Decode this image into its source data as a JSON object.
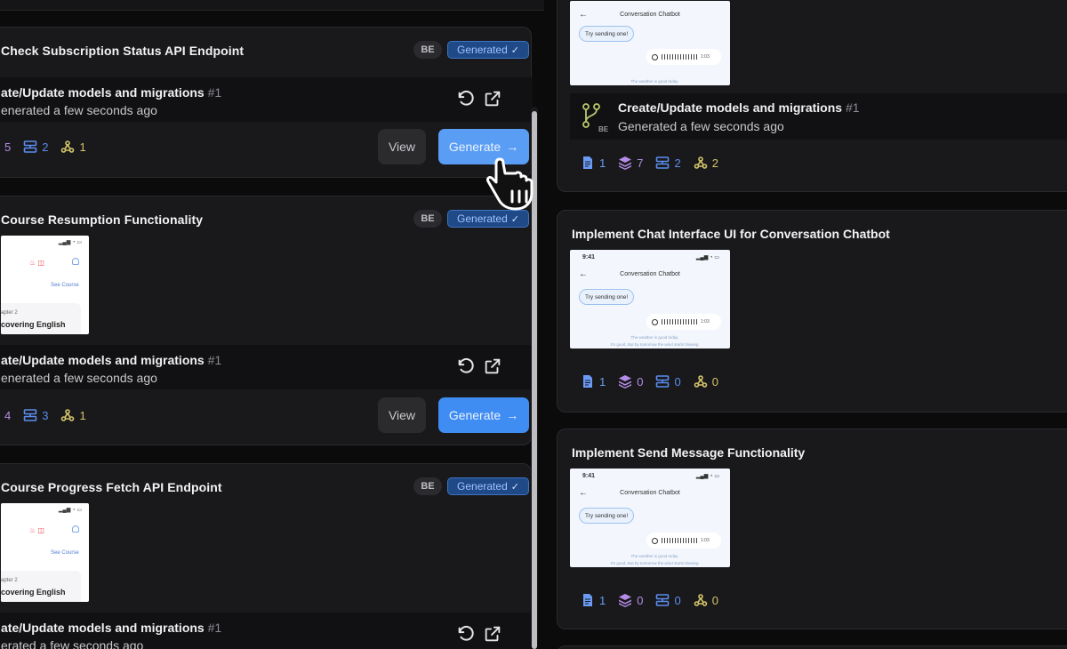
{
  "left_tasks": [
    {
      "title": "Check Subscription Status API Endpoint",
      "badge_be": "BE",
      "badge_status": "Generated",
      "has_thumbnail": false,
      "generation": {
        "title": "ate/Update models and migrations",
        "number": "#1",
        "time": "enerated a few seconds ago"
      },
      "stats": [
        "5",
        "2",
        "1"
      ],
      "view_label": "View",
      "generate_label": "Generate"
    },
    {
      "title": "Course Resumption Functionality",
      "badge_be": "BE",
      "badge_status": "Generated",
      "has_thumbnail": true,
      "thumbnail": {
        "see_course": "See Course",
        "chapter": "apter 2",
        "course_name": "covering English"
      },
      "generation": {
        "title": "ate/Update models and migrations",
        "number": "#1",
        "time": "enerated a few seconds ago"
      },
      "stats": [
        "4",
        "3",
        "1"
      ],
      "view_label": "View",
      "generate_label": "Generate"
    },
    {
      "title": "Course Progress Fetch API Endpoint",
      "badge_be": "BE",
      "badge_status": "Generated",
      "has_thumbnail": true,
      "thumbnail": {
        "see_course": "See Course",
        "chapter": "apter 2",
        "course_name": "covering English"
      },
      "generation": {
        "title": "ate/Update models and migrations",
        "number": "#1",
        "time": "erated a few seconds ago"
      }
    }
  ],
  "right_tasks": [
    {
      "thumbnail": {
        "header": "Conversation Chatbot",
        "bubble": "Try sending one!",
        "voice_time": "1:03",
        "footer": "The weather is good today"
      },
      "generation": {
        "badge": "BE",
        "title": "Create/Update models and migrations",
        "number": "#1",
        "time": "Generated a few seconds ago"
      },
      "stats": [
        "1",
        "7",
        "2",
        "2"
      ]
    },
    {
      "title": "Implement Chat Interface UI for Conversation Chatbot",
      "thumbnail": {
        "time": "9:41",
        "header": "Conversation Chatbot",
        "bubble": "Try sending one!",
        "voice_time": "1:03",
        "footer": "The weather is good today",
        "footer2": "It's good, But by tomorrow the wind starts blowing"
      },
      "stats": [
        "1",
        "0",
        "0",
        "0"
      ]
    },
    {
      "title": "Implement Send Message Functionality",
      "thumbnail": {
        "time": "9:41",
        "header": "Conversation Chatbot",
        "bubble": "Try sending one!",
        "voice_time": "1:03",
        "footer": "The weather is good today",
        "footer2": "It's good, But by tomorrow the wind starts blowing"
      },
      "stats": [
        "1",
        "0",
        "0",
        "0"
      ]
    }
  ],
  "icons": {
    "check": "✓",
    "arrow": "→",
    "back": "←",
    "flame": "🔥"
  },
  "colors": {
    "generate_button": "#3f8cf2",
    "generated_badge": "#1f4a87",
    "doc_icon": "#5b8def",
    "stack_icon": "#b58ce9",
    "hook_icon": "#d3c46a"
  }
}
